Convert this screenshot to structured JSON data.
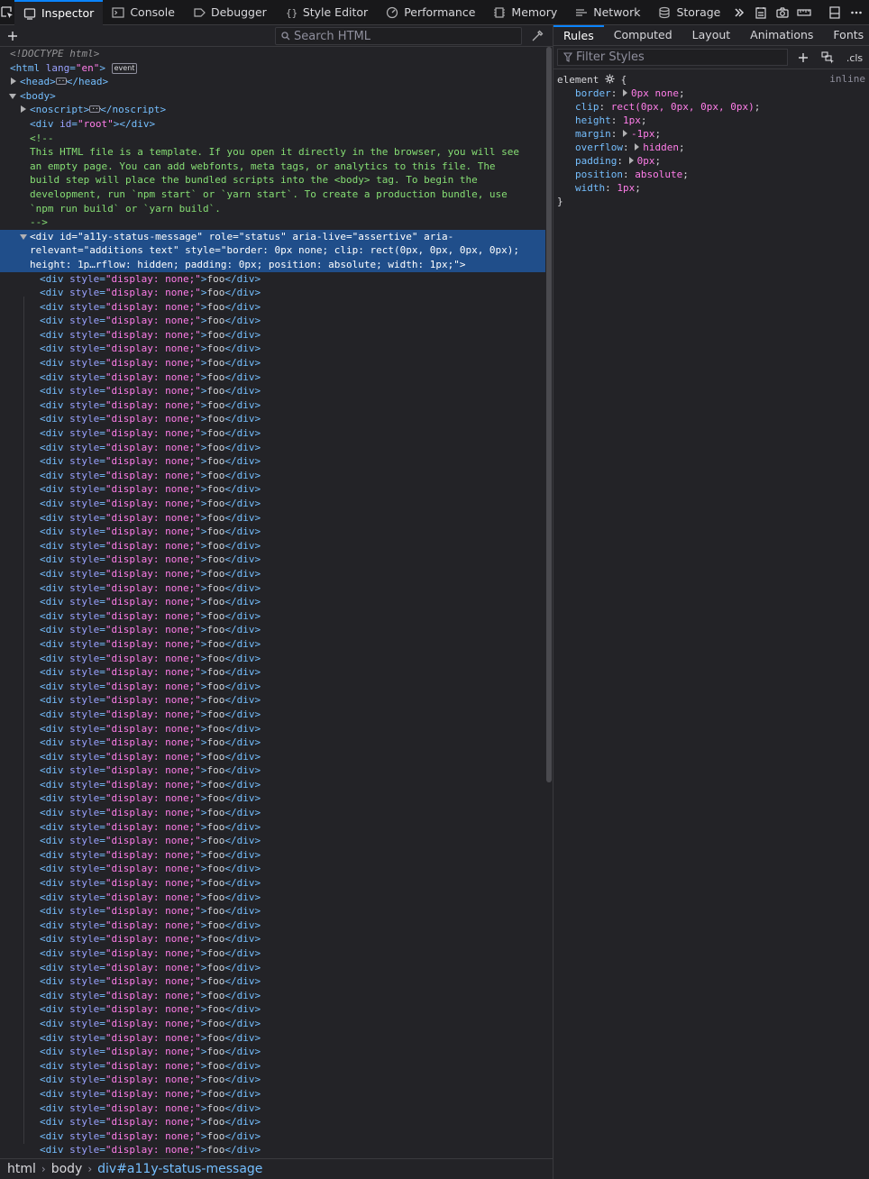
{
  "toolbar": {
    "tabs": [
      {
        "label": "Inspector",
        "icon": "inspector-icon",
        "active": true
      },
      {
        "label": "Console",
        "icon": "console-icon"
      },
      {
        "label": "Debugger",
        "icon": "debugger-icon"
      },
      {
        "label": "Style Editor",
        "icon": "style-editor-icon"
      },
      {
        "label": "Performance",
        "icon": "performance-icon"
      },
      {
        "label": "Memory",
        "icon": "memory-icon"
      },
      {
        "label": "Network",
        "icon": "network-icon"
      },
      {
        "label": "Storage",
        "icon": "storage-icon"
      }
    ]
  },
  "markup": {
    "search_placeholder": "Search HTML",
    "doctype": "<!DOCTYPE html>",
    "html_open": "<html",
    "html_lang_attr": "lang",
    "html_lang_val": "\"en\"",
    "html_close": ">",
    "event_badge": "event",
    "head_open": "<head>",
    "head_close": "</head>",
    "body_open": "<body>",
    "noscript_open": "<noscript>",
    "noscript_close": "</noscript>",
    "root_div_open": "<div",
    "root_div_attr": "id",
    "root_div_val": "\"root\"",
    "root_div_close": "></div>",
    "comment_open": "<!--",
    "comment_lines": [
      "This HTML file is a template. If you open it directly in the browser, you will see",
      "an empty page. You can add webfonts, meta tags, or analytics to this file. The",
      "build step will place the bundled scripts into the <body> tag. To begin the",
      "development, run `npm start` or `yarn start`. To create a production bundle, use",
      "`npm run build` or `yarn build`."
    ],
    "comment_close": "-->",
    "selected_lines": [
      "<div id=\"a11y-status-message\" role=\"status\" aria-live=\"assertive\" aria-",
      "relevant=\"additions text\" style=\"border: 0px none; clip: rect(0px, 0px, 0px, 0px);",
      "height: 1p…rflow: hidden; padding: 0px; position: absolute; width: 1px;\">"
    ],
    "child_tag_open": "<div",
    "child_attr": "style",
    "child_attr_value": "\"display: none;\"",
    "child_text": "foo",
    "child_tag_close": "</div>",
    "child_count": 63
  },
  "breadcrumbs": [
    "html",
    "body",
    "div#a11y-status-message"
  ],
  "sidebar": {
    "tabs": [
      "Rules",
      "Computed",
      "Layout",
      "Animations",
      "Fonts"
    ],
    "active_tab": "Rules",
    "filter_placeholder": "Filter Styles",
    "cls_label": ".cls",
    "rule": {
      "selector": "element",
      "open_brace": "{",
      "source": "inline",
      "declarations": [
        {
          "prop": "border",
          "value": "0px none",
          "expandable": true
        },
        {
          "prop": "clip",
          "value": "rect(0px, 0px, 0px, 0px)",
          "expandable": false
        },
        {
          "prop": "height",
          "value": "1px",
          "expandable": false
        },
        {
          "prop": "margin",
          "value": "-1px",
          "expandable": true
        },
        {
          "prop": "overflow",
          "value": "hidden",
          "expandable": true
        },
        {
          "prop": "padding",
          "value": "0px",
          "expandable": true
        },
        {
          "prop": "position",
          "value": "absolute",
          "expandable": false
        },
        {
          "prop": "width",
          "value": "1px",
          "expandable": false
        }
      ],
      "close_brace": "}"
    }
  },
  "colors": {
    "accent": "#0a84ff",
    "selection": "#204e8a",
    "tag": "#75bfff",
    "attr_value": "#ff7de9",
    "comment": "#86de74"
  }
}
